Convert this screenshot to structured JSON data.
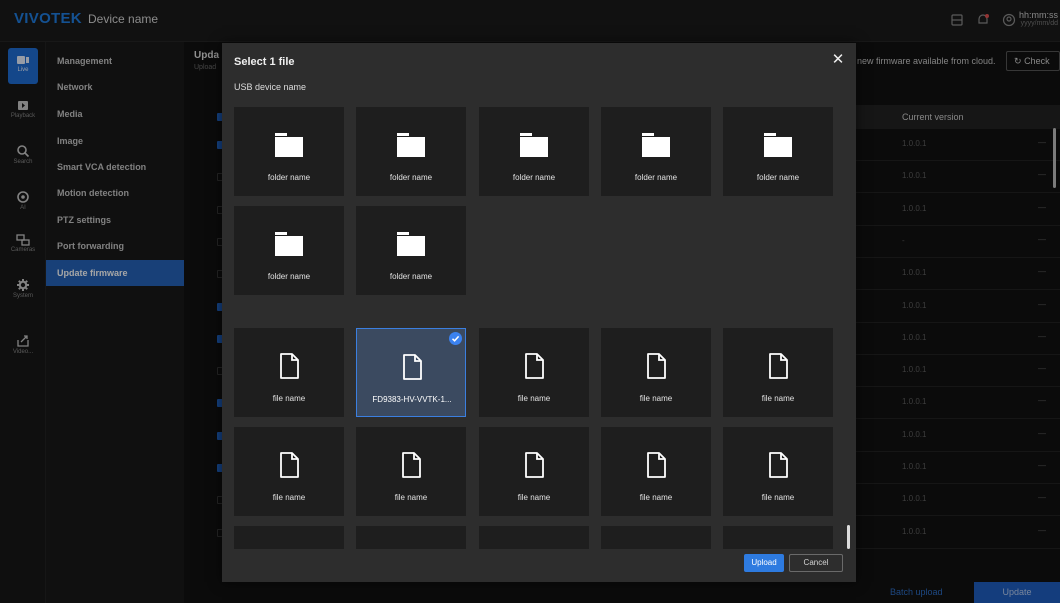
{
  "topbar": {
    "logo": "VIVOTEK",
    "device_name": "Device name",
    "clock_time": "hh:mm:ss",
    "clock_date": "yyyy/mm/dd",
    "icons": [
      "storage-icon",
      "notification-icon",
      "account-icon"
    ]
  },
  "iconbar": {
    "items": [
      {
        "label": "Live",
        "icon": "live-icon",
        "active": true
      },
      {
        "label": "Playback",
        "icon": "playback-icon"
      },
      {
        "label": "Search",
        "icon": "search-icon"
      },
      {
        "label": "AI",
        "icon": "ai-icon"
      },
      {
        "label": "Cameras",
        "icon": "cameras-icon"
      },
      {
        "label": "System",
        "icon": "system-icon"
      },
      {
        "label": "Video...",
        "icon": "video-export-icon"
      }
    ]
  },
  "menu": {
    "items": [
      {
        "label": "Management"
      },
      {
        "label": "Network"
      },
      {
        "label": "Media"
      },
      {
        "label": "Image"
      },
      {
        "label": "Smart VCA detection"
      },
      {
        "label": "Motion detection"
      },
      {
        "label": "PTZ settings"
      },
      {
        "label": "Port forwarding"
      },
      {
        "label": "Update firmware",
        "active": true
      }
    ]
  },
  "main": {
    "title": "Upda",
    "subtitle": "Upload",
    "cloud_text": "new firmware available from cloud.",
    "check_label": "Check",
    "column_current_version": "Current version",
    "rows": [
      {
        "version": "1.0.0.1",
        "checked": true
      },
      {
        "version": "1.0.0.1",
        "checked": false
      },
      {
        "version": "1.0.0.1",
        "checked": false
      },
      {
        "version": "-",
        "checked": false
      },
      {
        "version": "1.0.0.1",
        "checked": false
      },
      {
        "version": "1.0.0.1",
        "checked": true
      },
      {
        "version": "1.0.0.1",
        "checked": true
      },
      {
        "version": "1.0.0.1",
        "checked": false
      },
      {
        "version": "1.0.0.1",
        "checked": true
      },
      {
        "version": "1.0.0.1",
        "checked": true
      },
      {
        "version": "1.0.0.1",
        "checked": true
      },
      {
        "version": "1.0.0.1",
        "checked": false
      },
      {
        "version": "1.0.0.1",
        "checked": false
      }
    ],
    "row_menu": "—",
    "batch_upload": "Batch upload",
    "update_label": "Update"
  },
  "dialog": {
    "title": "Select 1 file",
    "close": "✕",
    "source": "USB device name",
    "folders": [
      "folder name",
      "folder name",
      "folder name",
      "folder name",
      "folder name",
      "folder name",
      "folder name"
    ],
    "files": [
      {
        "name": "file name"
      },
      {
        "name": "FD9383-HV-VVTK-1...",
        "selected": true
      },
      {
        "name": "file name"
      },
      {
        "name": "file name"
      },
      {
        "name": "file name"
      },
      {
        "name": "file name"
      },
      {
        "name": "file name"
      },
      {
        "name": "file name"
      },
      {
        "name": "file name"
      },
      {
        "name": "file name"
      }
    ],
    "upload_label": "Upload",
    "cancel_label": "Cancel"
  }
}
